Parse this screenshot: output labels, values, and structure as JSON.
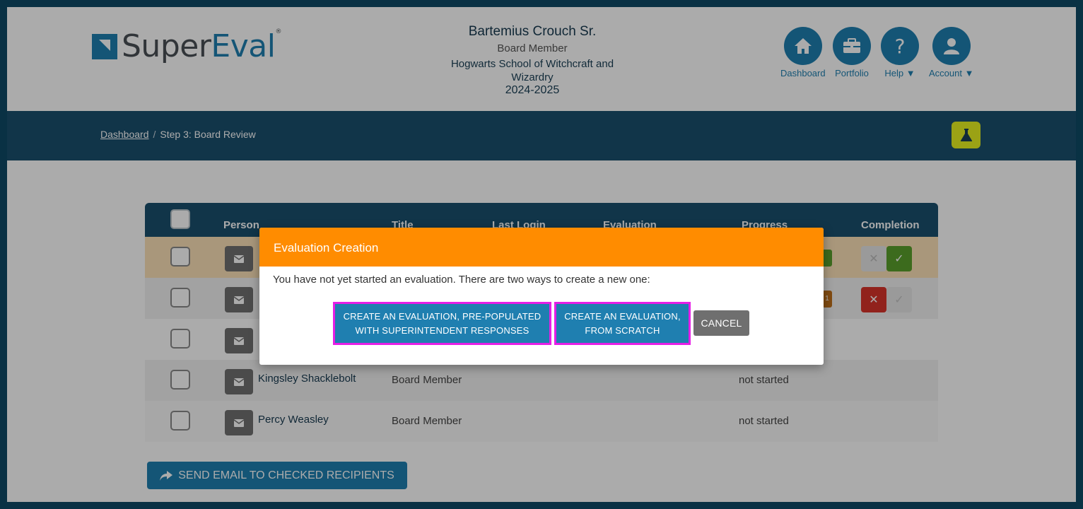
{
  "header": {
    "logo": {
      "super": "Super",
      "eval": "Eval",
      "mark": "®"
    },
    "user": {
      "name": "Bartemius Crouch Sr.",
      "role": "Board Member",
      "school": "Hogwarts School of Witchcraft and Wizardry",
      "year": "2024-2025"
    },
    "nav": [
      {
        "label": "Dashboard",
        "icon": "home-icon"
      },
      {
        "label": "Portfolio",
        "icon": "briefcase-icon"
      },
      {
        "label": "Help",
        "icon": "question-icon"
      },
      {
        "label": "Account",
        "icon": "user-icon"
      }
    ]
  },
  "breadcrumb": {
    "home": "Dashboard",
    "separator": "/",
    "current": "Step 3: Board Review"
  },
  "table": {
    "columns": [
      "Person",
      "Title",
      "Last Login",
      "Evaluation",
      "Progress",
      "Completion"
    ],
    "rows": [
      {
        "name": "",
        "title": "",
        "progress": ""
      },
      {
        "name": "",
        "title": "",
        "progress": ""
      },
      {
        "name": "",
        "title": "",
        "progress": ""
      },
      {
        "name": "Kingsley Shacklebolt",
        "title": "Board Member",
        "progress": "not started"
      },
      {
        "name": "Percy Weasley",
        "title": "Board Member",
        "progress": "not started"
      }
    ],
    "badge_count": "1"
  },
  "send_button": {
    "label": "SEND EMAIL TO CHECKED RECIPIENTS"
  },
  "modal": {
    "title": "Evaluation Creation",
    "message": "You have not yet started an evaluation. There are two ways to create a new one:",
    "buttons": {
      "prepopulated": "CREATE AN EVALUATION, PRE-POPULATED WITH SUPERINTENDENT RESPONSES",
      "scratch": "CREATE AN EVALUATION, FROM SCRATCH",
      "cancel": "CANCEL"
    }
  },
  "colors": {
    "brand": "#1f7fb0",
    "navbar": "#1a4f6e",
    "modal_header": "#ff8c00",
    "highlight": "#e61ee6",
    "flask_button": "#e8f220"
  }
}
